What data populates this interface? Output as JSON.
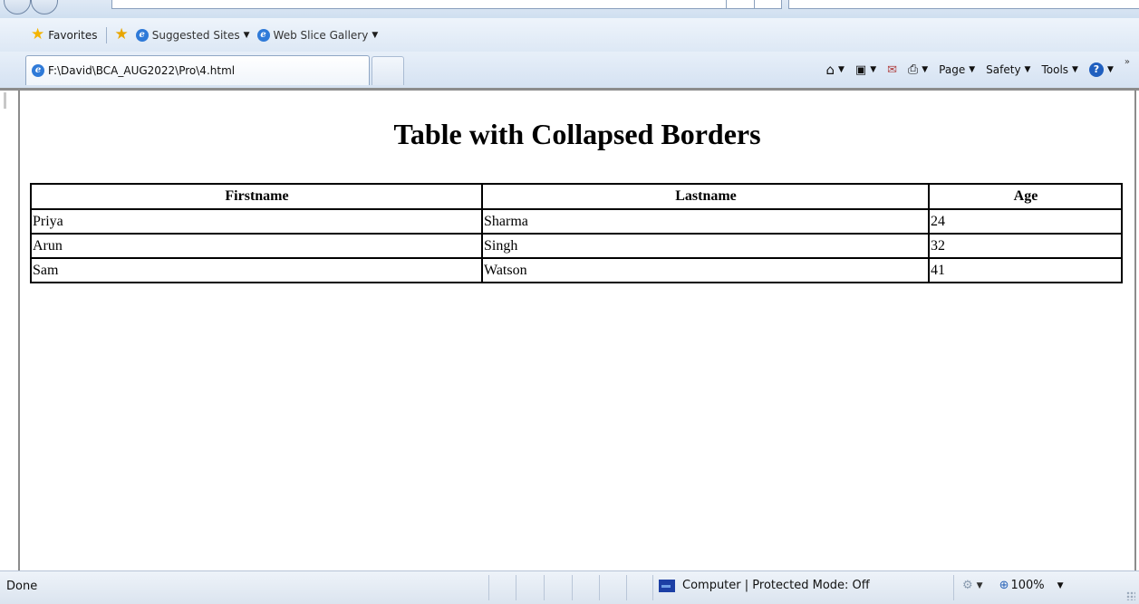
{
  "browser": {
    "favorites_bar": {
      "favorites_label": "Favorites",
      "items": [
        {
          "label": "Suggested Sites"
        },
        {
          "label": "Web Slice Gallery"
        }
      ]
    },
    "tab": {
      "title": "F:\\David\\BCA_AUG2022\\Pro\\4.html"
    },
    "command_bar": {
      "page_label": "Page",
      "safety_label": "Safety",
      "tools_label": "Tools"
    },
    "status_bar": {
      "status_text": "Done",
      "zone_text": "Computer | Protected Mode: Off",
      "zoom": "100%"
    }
  },
  "page": {
    "title": "Table with Collapsed Borders",
    "table": {
      "headers": [
        "Firstname",
        "Lastname",
        "Age"
      ],
      "rows": [
        [
          "Priya",
          "Sharma",
          "24"
        ],
        [
          "Arun",
          "Singh",
          "32"
        ],
        [
          "Sam",
          "Watson",
          "41"
        ]
      ]
    }
  }
}
